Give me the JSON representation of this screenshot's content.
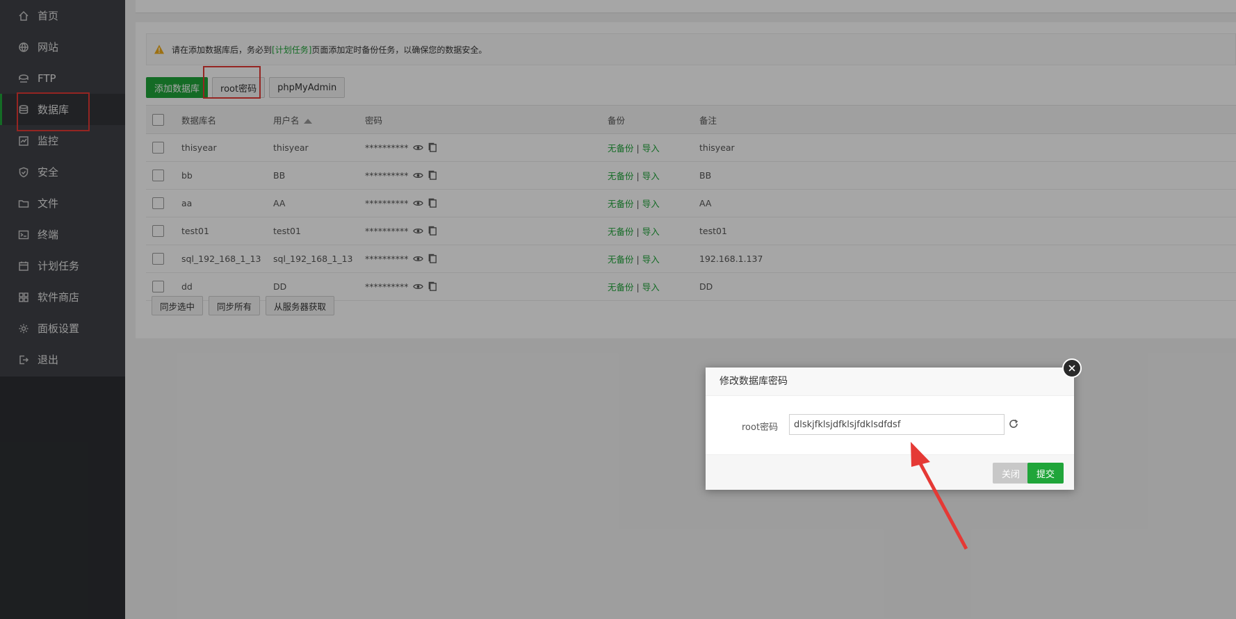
{
  "sidebar": {
    "items": [
      {
        "label": "首页",
        "icon": "home-icon"
      },
      {
        "label": "网站",
        "icon": "globe-icon"
      },
      {
        "label": "FTP",
        "icon": "ftp-icon"
      },
      {
        "label": "数据库",
        "icon": "database-icon",
        "active": true
      },
      {
        "label": "监控",
        "icon": "monitor-icon"
      },
      {
        "label": "安全",
        "icon": "shield-icon"
      },
      {
        "label": "文件",
        "icon": "folder-icon"
      },
      {
        "label": "终端",
        "icon": "terminal-icon"
      },
      {
        "label": "计划任务",
        "icon": "calendar-icon"
      },
      {
        "label": "软件商店",
        "icon": "grid-icon"
      },
      {
        "label": "面板设置",
        "icon": "gear-icon"
      },
      {
        "label": "退出",
        "icon": "logout-icon"
      }
    ]
  },
  "tip": {
    "prefix": "请在添加数据库后，务必到",
    "link": "[计划任务]",
    "suffix": "页面添加定时备份任务，以确保您的数据安全。"
  },
  "toolbar": {
    "add_label": "添加数据库",
    "root_label": "root密码",
    "pma_label": "phpMyAdmin"
  },
  "table": {
    "headers": [
      "数据库名",
      "用户名",
      "密码",
      "备份",
      "备注"
    ],
    "rows": [
      {
        "name": "thisyear",
        "user": "thisyear",
        "password": "**********",
        "backup": "无备份",
        "import": "导入",
        "note": "thisyear"
      },
      {
        "name": "bb",
        "user": "BB",
        "password": "**********",
        "backup": "无备份",
        "import": "导入",
        "note": "BB"
      },
      {
        "name": "aa",
        "user": "AA",
        "password": "**********",
        "backup": "无备份",
        "import": "导入",
        "note": "AA"
      },
      {
        "name": "test01",
        "user": "test01",
        "password": "**********",
        "backup": "无备份",
        "import": "导入",
        "note": "test01"
      },
      {
        "name": "sql_192_168_1_13",
        "user": "sql_192_168_1_13",
        "password": "**********",
        "backup": "无备份",
        "import": "导入",
        "note": "192.168.1.137"
      },
      {
        "name": "dd",
        "user": "DD",
        "password": "**********",
        "backup": "无备份",
        "import": "导入",
        "note": "DD"
      }
    ]
  },
  "footer_buttons": {
    "sync_selected": "同步选中",
    "sync_all": "同步所有",
    "fetch_server": "从服务器获取"
  },
  "dialog": {
    "title": "修改数据库密码",
    "field_label": "root密码",
    "field_value": "dlskjfklsjdfklsjfdklsdfdsf",
    "close_label": "关闭",
    "submit_label": "提交"
  },
  "colors": {
    "accent": "#20a53a",
    "highlight": "#e53935",
    "sidebar": "#3f4147"
  }
}
